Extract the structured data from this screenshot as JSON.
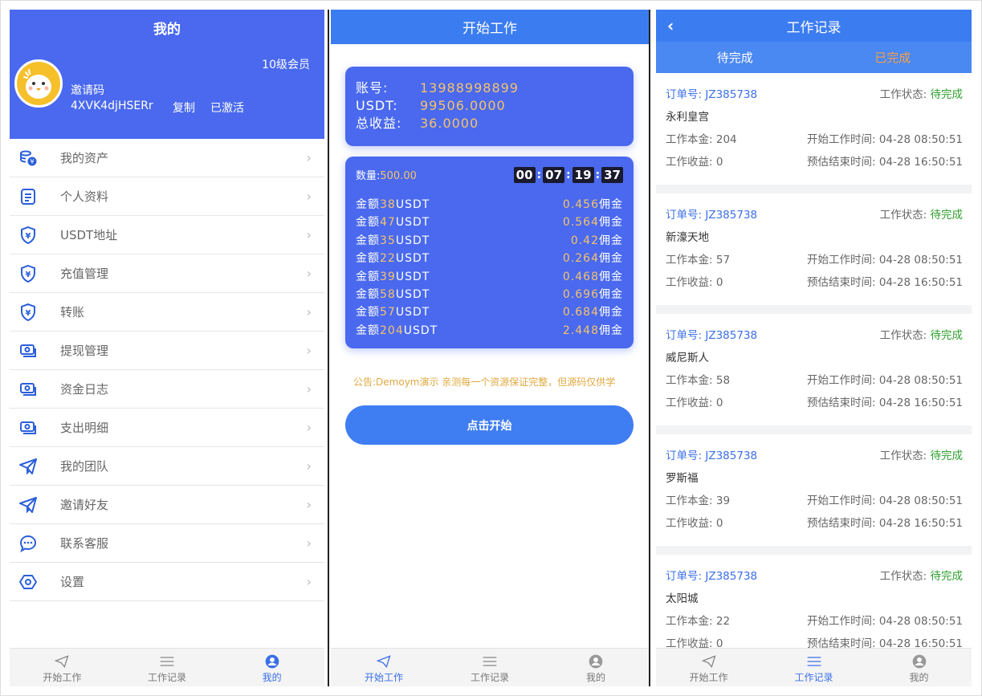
{
  "profile": {
    "title": "我的",
    "invite_label": "邀请码",
    "invite_code": "4XVK4djHSERr",
    "copy_label": "复制",
    "activated_label": "已激活",
    "level": "10级会员",
    "menu": [
      {
        "label": "我的资产",
        "icon": "wallet-coins-icon"
      },
      {
        "label": "个人资料",
        "icon": "document-icon"
      },
      {
        "label": "USDT地址",
        "icon": "yen-shield-icon"
      },
      {
        "label": "充值管理",
        "icon": "yen-shield-icon"
      },
      {
        "label": "转账",
        "icon": "yen-shield-icon"
      },
      {
        "label": "提现管理",
        "icon": "cash-icon"
      },
      {
        "label": "资金日志",
        "icon": "cash-icon"
      },
      {
        "label": "支出明细",
        "icon": "cash-icon"
      },
      {
        "label": "我的团队",
        "icon": "paper-plane-icon"
      },
      {
        "label": "邀请好友",
        "icon": "paper-plane-icon"
      },
      {
        "label": "联系客服",
        "icon": "chat-icon"
      },
      {
        "label": "设置",
        "icon": "settings-hex-icon"
      }
    ],
    "arrow": "›"
  },
  "tabbar": {
    "start": "开始工作",
    "records": "工作记录",
    "mine": "我的"
  },
  "work": {
    "title": "开始工作",
    "account_label": "账号:",
    "account": "13988998899",
    "usdt_label": "USDT:",
    "usdt": "99506.0000",
    "earnings_label": "总收益:",
    "earnings": "36.0000",
    "qty_label": "数量:",
    "qty": "500.00",
    "timer": [
      "00",
      "07",
      "19",
      "37"
    ],
    "orders": [
      {
        "prefix": "金额",
        "amount": "38",
        "unit": "USDT",
        "commission": "0.456",
        "suffix": "佣金"
      },
      {
        "prefix": "金额",
        "amount": "47",
        "unit": "USDT",
        "commission": "0.564",
        "suffix": "佣金"
      },
      {
        "prefix": "金额",
        "amount": "35",
        "unit": "USDT",
        "commission": "0.42",
        "suffix": "佣金"
      },
      {
        "prefix": "金额",
        "amount": "22",
        "unit": "USDT",
        "commission": "0.264",
        "suffix": "佣金"
      },
      {
        "prefix": "金额",
        "amount": "39",
        "unit": "USDT",
        "commission": "0.468",
        "suffix": "佣金"
      },
      {
        "prefix": "金额",
        "amount": "58",
        "unit": "USDT",
        "commission": "0.696",
        "suffix": "佣金"
      },
      {
        "prefix": "金额",
        "amount": "57",
        "unit": "USDT",
        "commission": "0.684",
        "suffix": "佣金"
      },
      {
        "prefix": "金额",
        "amount": "204",
        "unit": "USDT",
        "commission": "2.448",
        "suffix": "佣金"
      }
    ],
    "notice": "公告:Demoym演示 亲测每一个资源保证完整，但源码仅供学",
    "start_button": "点击开始"
  },
  "records": {
    "title": "工作记录",
    "back": "‹",
    "tab_pending": "待完成",
    "tab_done": "已完成",
    "order_label": "订单号:",
    "status_label": "工作状态:",
    "principal_label": "工作本金:",
    "income_label": "工作收益:",
    "start_time_label": "开始工作时间:",
    "end_time_label": "预估结束时间:",
    "items": [
      {
        "order": "JZ385738",
        "status": "待完成",
        "place": "永利皇宫",
        "principal": "204",
        "income": "0",
        "start": "04-28 08:50:51",
        "end": "04-28 16:50:51"
      },
      {
        "order": "JZ385738",
        "status": "待完成",
        "place": "新濠天地",
        "principal": "57",
        "income": "0",
        "start": "04-28 08:50:51",
        "end": "04-28 16:50:51"
      },
      {
        "order": "JZ385738",
        "status": "待完成",
        "place": "威尼斯人",
        "principal": "58",
        "income": "0",
        "start": "04-28 08:50:51",
        "end": "04-28 16:50:51"
      },
      {
        "order": "JZ385738",
        "status": "待完成",
        "place": "罗斯福",
        "principal": "39",
        "income": "0",
        "start": "04-28 08:50:51",
        "end": "04-28 16:50:51"
      },
      {
        "order": "JZ385738",
        "status": "待完成",
        "place": "太阳城",
        "principal": "22",
        "income": "0",
        "start": "04-28 08:50:51",
        "end": "04-28 16:50:51"
      }
    ]
  },
  "colors": {
    "primary": "#4a69ee",
    "header_blue": "#3b7cf1",
    "gold": "#f5c26b",
    "status_green": "#2f9f2f",
    "tab_orange": "#f5a04a"
  }
}
